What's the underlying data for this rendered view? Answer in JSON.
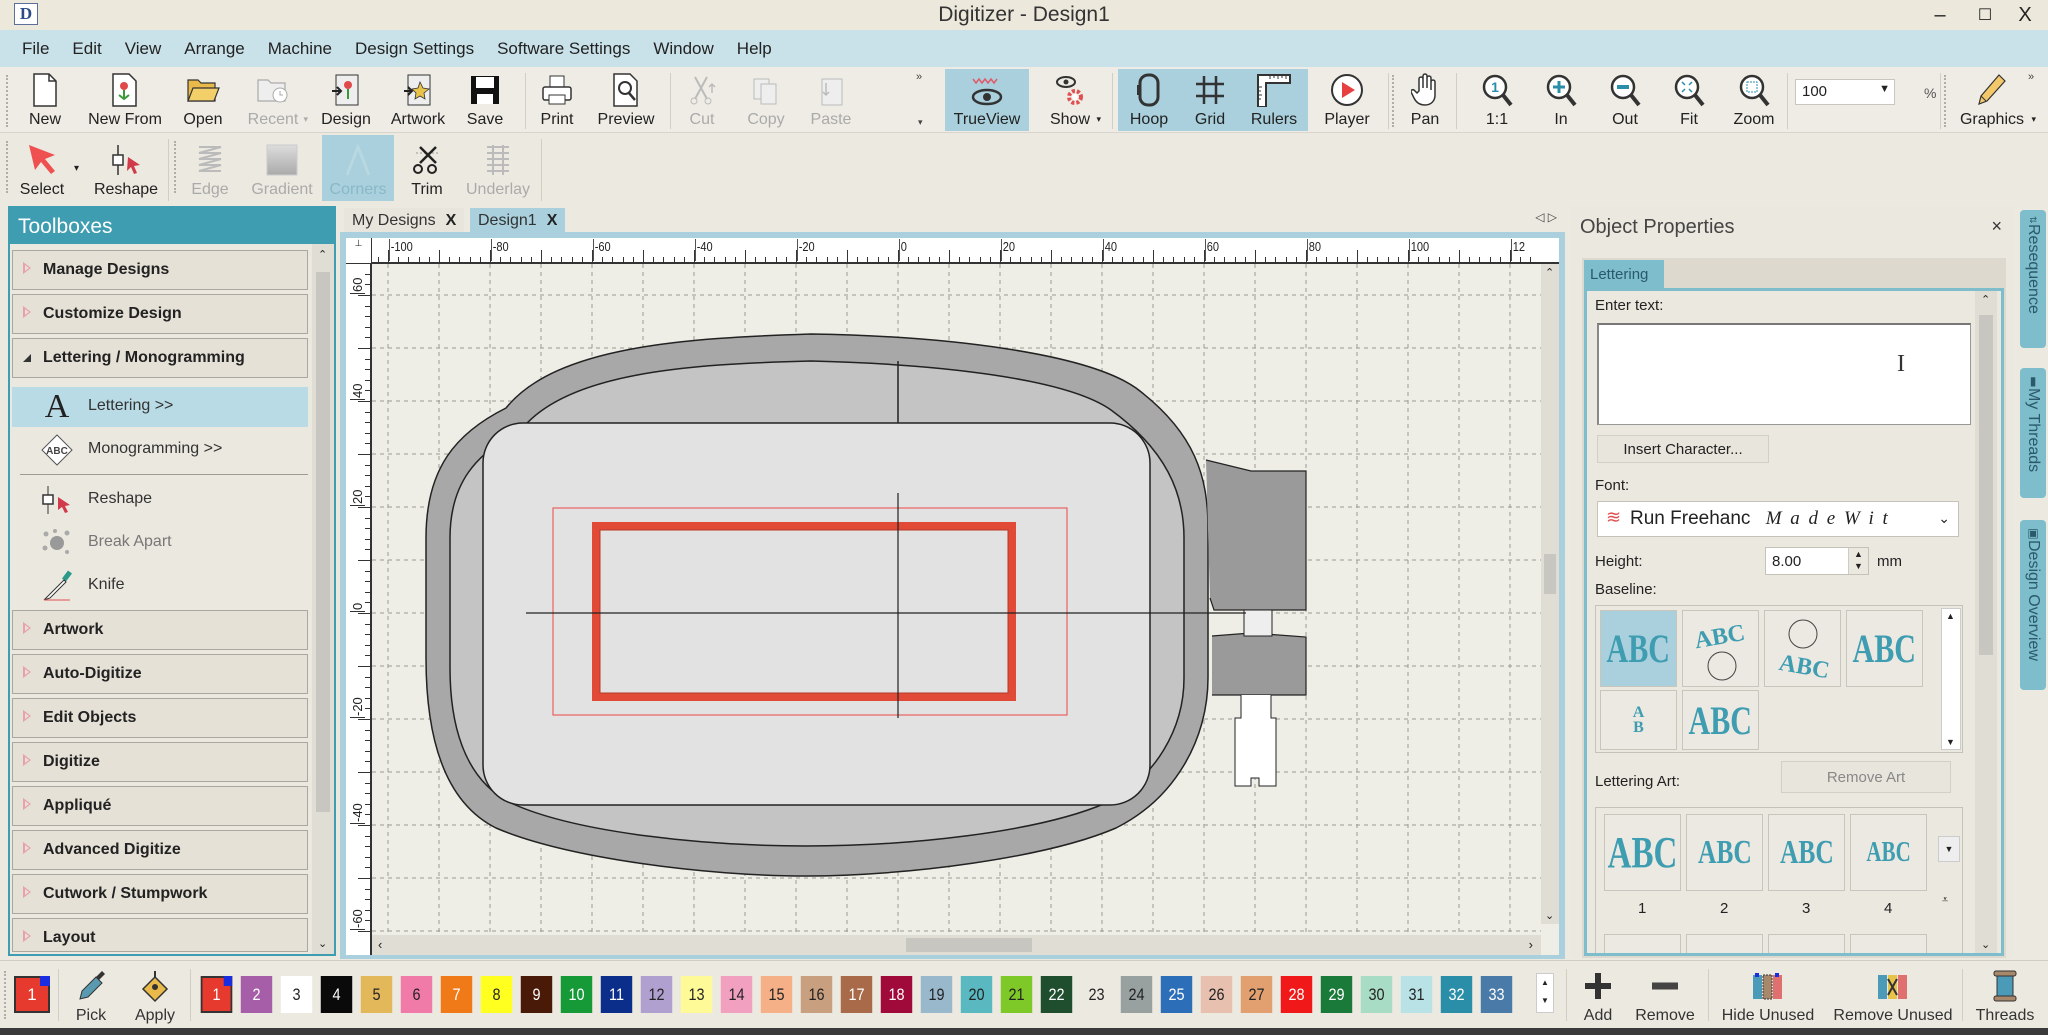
{
  "window": {
    "title": "Digitizer - Design1",
    "app_icon": "D",
    "minimize": "–",
    "maximize": "☐",
    "close": "X"
  },
  "menu": [
    "File",
    "Edit",
    "View",
    "Arrange",
    "Machine",
    "Design Settings",
    "Software Settings",
    "Window",
    "Help"
  ],
  "toolbar1": {
    "new": "New",
    "new_from": "New From",
    "open": "Open",
    "recent": "Recent",
    "design": "Design",
    "artwork": "Artwork",
    "save": "Save",
    "print": "Print",
    "preview": "Preview",
    "cut": "Cut",
    "copy": "Copy",
    "paste": "Paste",
    "trueview": "TrueView",
    "show": "Show",
    "hoop": "Hoop",
    "grid": "Grid",
    "rulers": "Rulers",
    "player": "Player",
    "pan": "Pan",
    "zoom_1_1": "1:1",
    "zoom_in": "In",
    "zoom_out": "Out",
    "fit": "Fit",
    "zoom": "Zoom",
    "zoom_value": "100",
    "zoom_unit": "%",
    "graphics": "Graphics"
  },
  "toolbar2": {
    "select": "Select",
    "reshape": "Reshape",
    "edge": "Edge",
    "gradient": "Gradient",
    "corners": "Corners",
    "trim": "Trim",
    "underlay": "Underlay"
  },
  "toolboxes": {
    "title": "Toolboxes",
    "sections_top": [
      "Manage Designs",
      "Customize Design"
    ],
    "expanded": "Lettering / Monogramming",
    "tools": [
      "Lettering >>",
      "Monogramming >>",
      "Reshape",
      "Break Apart",
      "Knife"
    ],
    "sections_bottom": [
      "Artwork",
      "Auto-Digitize",
      "Edit Objects",
      "Digitize",
      "Appliqué",
      "Advanced Digitize",
      "Cutwork / Stumpwork",
      "Layout"
    ]
  },
  "tabs": [
    {
      "label": "My Designs",
      "close": "X"
    },
    {
      "label": "Design1",
      "close": "X"
    }
  ],
  "rulers": {
    "x_ticks": [
      "-100",
      "-80",
      "-60",
      "-40",
      "-20",
      "0",
      "20",
      "40",
      "60",
      "80",
      "100",
      "12"
    ],
    "y_ticks": [
      "60",
      "40",
      "20",
      "0",
      "-20",
      "-40",
      "-60"
    ]
  },
  "properties": {
    "title": "Object Properties",
    "close": "×",
    "tab": "Lettering",
    "enter_text_label": "Enter text:",
    "enter_text_value": "",
    "insert_character": "Insert Character...",
    "font_label": "Font:",
    "font_value": "Run Freehanc",
    "font_sample": "M a d e  W i t",
    "height_label": "Height:",
    "height_value": "8.00",
    "height_unit": "mm",
    "baseline_label": "Baseline:",
    "baseline_options": [
      "ABC",
      "ABC",
      "ABC",
      "ABC",
      "AB",
      "ABC"
    ],
    "lettering_art_label": "Lettering Art:",
    "remove_art": "Remove Art",
    "art_options": [
      {
        "label": "ABC",
        "num": "1"
      },
      {
        "label": "ABC",
        "num": "2"
      },
      {
        "label": "ABC",
        "num": "3"
      },
      {
        "label": "ABC",
        "num": "4"
      }
    ]
  },
  "side_tabs": [
    "Resequence",
    "My Threads",
    "Design Overview"
  ],
  "bottom": {
    "current_color": "1",
    "pick": "Pick",
    "apply": "Apply",
    "swatches": [
      {
        "n": "1",
        "c": "#e63a2e",
        "t": "#fff"
      },
      {
        "n": "2",
        "c": "#a65ea8",
        "t": "#fff"
      },
      {
        "n": "3",
        "c": "#ffffff",
        "t": "#222"
      },
      {
        "n": "4",
        "c": "#0a0a0a",
        "t": "#fff"
      },
      {
        "n": "5",
        "c": "#e2b85a",
        "t": "#222"
      },
      {
        "n": "6",
        "c": "#f07aa8",
        "t": "#222"
      },
      {
        "n": "7",
        "c": "#f07a18",
        "t": "#fff"
      },
      {
        "n": "8",
        "c": "#ffff20",
        "t": "#222"
      },
      {
        "n": "9",
        "c": "#4a1a08",
        "t": "#fff"
      },
      {
        "n": "10",
        "c": "#169a38",
        "t": "#fff"
      },
      {
        "n": "11",
        "c": "#0a2e8a",
        "t": "#fff"
      },
      {
        "n": "12",
        "c": "#b0a0d0",
        "t": "#222"
      },
      {
        "n": "13",
        "c": "#fffa98",
        "t": "#222"
      },
      {
        "n": "14",
        "c": "#f2a0c0",
        "t": "#222"
      },
      {
        "n": "15",
        "c": "#f6b088",
        "t": "#222"
      },
      {
        "n": "16",
        "c": "#c8a080",
        "t": "#222"
      },
      {
        "n": "17",
        "c": "#a86a48",
        "t": "#fff"
      },
      {
        "n": "18",
        "c": "#a00a3a",
        "t": "#fff"
      },
      {
        "n": "19",
        "c": "#9ab8cc",
        "t": "#222"
      },
      {
        "n": "20",
        "c": "#5ab8c0",
        "t": "#222"
      },
      {
        "n": "21",
        "c": "#7ec828",
        "t": "#222"
      },
      {
        "n": "22",
        "c": "#1e4e2e",
        "t": "#fff"
      },
      {
        "n": "23",
        "c": "#ece9e0",
        "t": "#222"
      },
      {
        "n": "24",
        "c": "#98a0a0",
        "t": "#222"
      },
      {
        "n": "25",
        "c": "#2c6eb8",
        "t": "#fff"
      },
      {
        "n": "26",
        "c": "#e8c0b0",
        "t": "#222"
      },
      {
        "n": "27",
        "c": "#e2a070",
        "t": "#222"
      },
      {
        "n": "28",
        "c": "#f01818",
        "t": "#fff"
      },
      {
        "n": "29",
        "c": "#1a7a3a",
        "t": "#fff"
      },
      {
        "n": "30",
        "c": "#a8dcc4",
        "t": "#222"
      },
      {
        "n": "31",
        "c": "#b8e2e6",
        "t": "#222"
      },
      {
        "n": "32",
        "c": "#2a8ea8",
        "t": "#fff"
      },
      {
        "n": "33",
        "c": "#4a7aa8",
        "t": "#fff"
      }
    ],
    "add": "Add",
    "remove": "Remove",
    "hide_unused": "Hide Unused",
    "remove_unused": "Remove Unused",
    "threads": "Threads"
  },
  "colors": {
    "accent": "#3e9db1",
    "active_tool": "#a9d0dc",
    "design_stitch": "#e04a36"
  }
}
